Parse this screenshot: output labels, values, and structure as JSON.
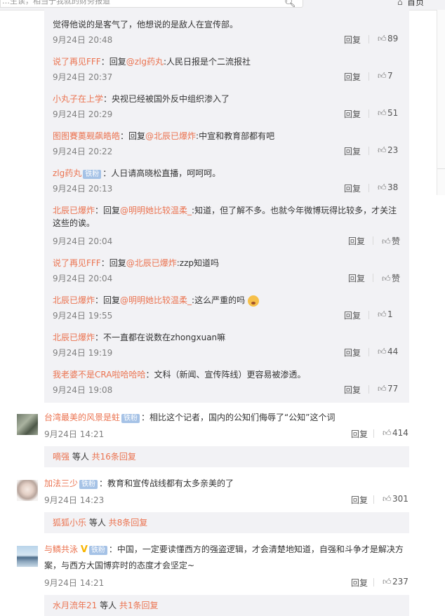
{
  "topbar": {
    "search_text": "…生读，相当于我就的财务报道",
    "home_label": "首页"
  },
  "sub_comments": [
    {
      "user": "",
      "reply_prefix": "",
      "at": "",
      "text": "觉得他说的是客气了，他想说的是敌人在宣传部。",
      "time": "9月24日 20:48",
      "reply": "回复",
      "likes": "89"
    },
    {
      "user": "说了再见FFF",
      "reply_prefix": "：回复",
      "at": "@zlg药丸",
      "text": ":人民日报是个二流报社",
      "time": "9月24日 20:37",
      "reply": "回复",
      "likes": "7"
    },
    {
      "user": "小丸子在上学",
      "reply_prefix": "",
      "at": "",
      "text": "：央视已经被国外反中组织渗入了",
      "time": "9月24日 20:29",
      "reply": "回复",
      "likes": "51"
    },
    {
      "user": "图图賽薁觋飙皓皓",
      "reply_prefix": "：回复",
      "at": "@北辰已爆炸",
      "text": ":中宣和教育部都有吧",
      "time": "9月24日 20:22",
      "reply": "回复",
      "likes": "23"
    },
    {
      "user": "zlg药丸",
      "badge": "铁粉",
      "reply_prefix": "",
      "at": "",
      "text": "：人日请高晓松直播，呵呵呵。",
      "time": "9月24日 20:13",
      "reply": "回复",
      "likes": "38"
    },
    {
      "user": "北辰已爆炸",
      "reply_prefix": "：回复",
      "at": "@明明她比较温柔_",
      "text": ":知道，但了解不多。也就今年微博玩得比较多，才关注",
      "text2": "这些的诶。",
      "time": "9月24日 20:04",
      "reply": "回复",
      "likes": "赞"
    },
    {
      "user": "说了再见FFF",
      "reply_prefix": "：回复",
      "at": "@北辰已爆炸",
      "text": ":zzp知道吗",
      "time": "9月24日 20:04",
      "reply": "回复",
      "likes": "赞"
    },
    {
      "user": "北辰已爆炸",
      "reply_prefix": "：回复",
      "at": "@明明她比较温柔_",
      "text": ":这么严重的吗",
      "time": "9月24日 19:55",
      "reply": "回复",
      "likes": "1"
    },
    {
      "user": "北辰已爆炸",
      "reply_prefix": "",
      "at": "",
      "text": "：不一直都在说数在zhongxuan嘛",
      "time": "9月24日 19:19",
      "reply": "回复",
      "likes": "44"
    },
    {
      "user": "我老婆不是CRA啦哈哈哈",
      "reply_prefix": "",
      "at": "",
      "text": "：文科（新闻、宣传阵线）更容易被渗透。",
      "time": "9月24日 19:08",
      "reply": "回复",
      "likes": "77"
    }
  ],
  "comments": [
    {
      "user": "台湾最美的风景是蛀",
      "badge": "铁粉",
      "text": "：相比这个记者，国内的公知们侮辱了“公知”这个词",
      "time": "9月24日 14:21",
      "reply": "回复",
      "likes": "414",
      "summary_user": "嘀强",
      "summary_mid": " 等人 ",
      "summary_link": "共16条回复"
    },
    {
      "user": "加法三少",
      "badge": "铁粉",
      "text": "：教育和宣传战线都有太多亲美的了",
      "time": "9月24日 14:23",
      "reply": "回复",
      "likes": "301",
      "summary_user": "狐狐小乐",
      "summary_mid": " 等人 ",
      "summary_link": "共8条回复"
    },
    {
      "user": "与鳞共泳",
      "badge": "铁粉",
      "text": "：中国，一定要读懂西方的强盗逻辑，才会清楚地知道，自强和斗争才是解决方",
      "text2": "案，与西方大国博弈时的态度才会坚定~",
      "time": "9月24日 14:21",
      "reply": "回复",
      "likes": "237",
      "summary_user": "水月流年21",
      "summary_mid": " 等人 ",
      "summary_link": "共1条回复"
    }
  ],
  "colors": {
    "link": "#eb7350",
    "badge": "#a5c2e6",
    "subbg": "#f2f2f5"
  }
}
